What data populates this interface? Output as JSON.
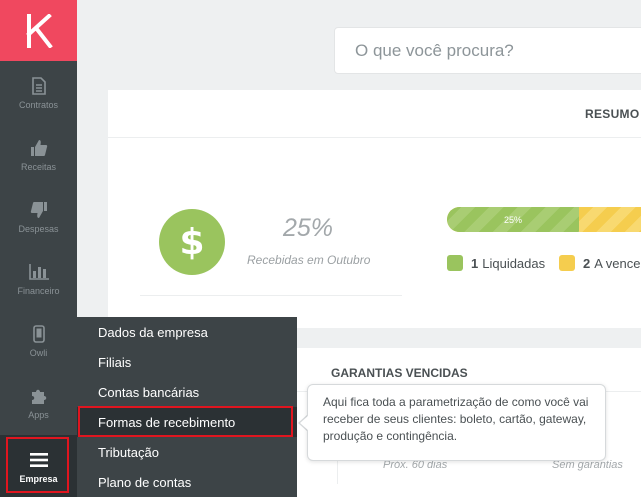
{
  "app": {
    "logo_letter": "K",
    "brand_color": "#f0485f"
  },
  "sidebar": {
    "items": [
      {
        "label": "Contratos",
        "icon": "document-icon"
      },
      {
        "label": "Receitas",
        "icon": "thumbs-up-icon"
      },
      {
        "label": "Despesas",
        "icon": "thumbs-down-icon"
      },
      {
        "label": "Financeiro",
        "icon": "bar-chart-icon"
      },
      {
        "label": "Owli",
        "icon": "phone-icon"
      },
      {
        "label": "Apps",
        "icon": "puzzle-icon"
      },
      {
        "label": "Empresa",
        "icon": "hamburger-icon",
        "active": true
      }
    ]
  },
  "search": {
    "placeholder": "O que você procura?"
  },
  "summary": {
    "title": "RESUMO",
    "percent": "25%",
    "caption": "Recebidas em Outubro",
    "progress_label": "25%",
    "progress_fraction": 0.68,
    "legend": [
      {
        "count": "1",
        "label": "Liquidadas",
        "color": "#9ac45e"
      },
      {
        "count": "2",
        "label": "A vencer",
        "color": "#f5cd4e"
      }
    ]
  },
  "guarantees": {
    "title": "GARANTIAS VENCIDAS",
    "items": [
      "Próx. 60 dias",
      "Sem garantias"
    ]
  },
  "menu": {
    "items": [
      "Dados da empresa",
      "Filiais",
      "Contas bancárias",
      "Formas de recebimento",
      "Tributação",
      "Plano de contas"
    ],
    "highlighted_index": 3
  },
  "tooltip": {
    "text": "Aqui fica toda a parametrização de como você vai receber de seus clientes: boleto, cartão, gateway, produção e contingência."
  }
}
